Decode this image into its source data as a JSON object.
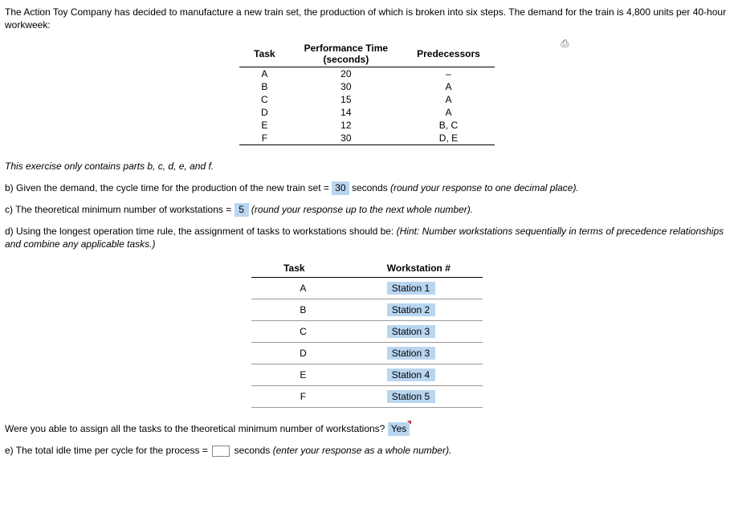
{
  "intro": "The Action Toy Company has decided to manufacture a new train set, the production of which is broken into six steps. The demand for the train is 4,800 units per 40-hour workweek:",
  "table1": {
    "headers": {
      "task": "Task",
      "perf": "Performance Time (seconds)",
      "pred": "Predecessors"
    },
    "rows": [
      {
        "task": "A",
        "time": "20",
        "pred": "–"
      },
      {
        "task": "B",
        "time": "30",
        "pred": "A"
      },
      {
        "task": "C",
        "time": "15",
        "pred": "A"
      },
      {
        "task": "D",
        "time": "14",
        "pred": "A"
      },
      {
        "task": "E",
        "time": "12",
        "pred": "B, C"
      },
      {
        "task": "F",
        "time": "30",
        "pred": "D, E"
      }
    ]
  },
  "note": "This exercise only contains parts b, c, d, e, and f.",
  "b": {
    "pre": "b) Given the demand, the cycle time for the production of the new train set =",
    "val": "30",
    "post": "seconds",
    "hint": "(round your response to one decimal place)."
  },
  "c": {
    "pre": "c) The theoretical minimum number of workstations =",
    "val": "5",
    "hint": "(round your response up to the next whole number)."
  },
  "d": {
    "text": "d) Using the longest operation time rule, the assignment of tasks to workstations should be:",
    "hint": "(Hint: Number workstations sequentially in terms of precedence relationships and combine any applicable tasks.)"
  },
  "table2": {
    "headers": {
      "task": "Task",
      "ws": "Workstation #"
    },
    "rows": [
      {
        "task": "A",
        "ws": "Station 1"
      },
      {
        "task": "B",
        "ws": "Station 2"
      },
      {
        "task": "C",
        "ws": "Station 3"
      },
      {
        "task": "D",
        "ws": "Station 3"
      },
      {
        "task": "E",
        "ws": "Station 4"
      },
      {
        "task": "F",
        "ws": "Station 5"
      }
    ]
  },
  "assigned_q": {
    "text": "Were you able to assign all the tasks to the theoretical minimum number of workstations?",
    "val": "Yes"
  },
  "e": {
    "pre": "e) The total idle time per cycle for the process =",
    "post": "seconds",
    "hint": "(enter your response as a whole number)."
  },
  "icons": {
    "print": "⎙"
  }
}
